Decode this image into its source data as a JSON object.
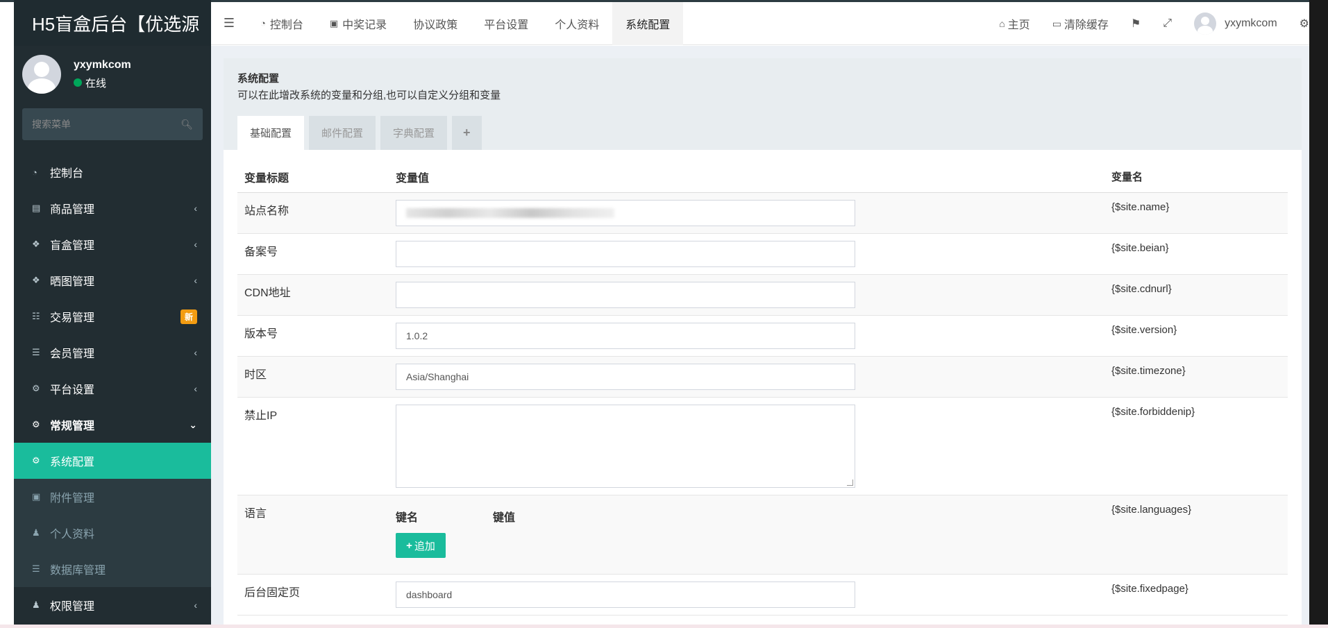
{
  "brand": {
    "title": "H5盲盒后台【优选源"
  },
  "user": {
    "name": "yxymkcom",
    "status": "在线"
  },
  "sidebar": {
    "search_placeholder": "搜索菜单",
    "items": [
      {
        "label": "控制台",
        "icon": "dashboard-icon"
      },
      {
        "label": "商品管理",
        "icon": "shopping-bag-icon"
      },
      {
        "label": "盲盒管理",
        "icon": "dropbox-icon"
      },
      {
        "label": "晒图管理",
        "icon": "dropbox-icon"
      },
      {
        "label": "交易管理",
        "icon": "cart-icon",
        "badge": "新"
      },
      {
        "label": "会员管理",
        "icon": "list-icon"
      },
      {
        "label": "平台设置",
        "icon": "cogs-icon"
      },
      {
        "label": "常规管理",
        "icon": "cogs-icon"
      },
      {
        "label": "系统配置",
        "icon": "gear-icon"
      },
      {
        "label": "附件管理",
        "icon": "image-icon"
      },
      {
        "label": "个人资料",
        "icon": "user-icon"
      },
      {
        "label": "数据库管理",
        "icon": "database-icon"
      },
      {
        "label": "权限管理",
        "icon": "group-icon"
      }
    ]
  },
  "topnav": {
    "tabs": [
      {
        "label": "控制台",
        "icon": "dashboard-icon"
      },
      {
        "label": "中奖记录",
        "icon": "gift-icon"
      },
      {
        "label": "协议政策"
      },
      {
        "label": "平台设置"
      },
      {
        "label": "个人资料"
      },
      {
        "label": "系统配置"
      }
    ],
    "right": {
      "home": "主页",
      "clear_cache": "清除缓存",
      "username": "yxymkcom"
    }
  },
  "panel": {
    "title": "系统配置",
    "description": "可以在此增改系统的变量和分组,也可以自定义分组和变量",
    "tabs": [
      "基础配置",
      "邮件配置",
      "字典配置"
    ],
    "plus": "+"
  },
  "table": {
    "headers": {
      "title": "变量标题",
      "value": "变量值",
      "name": "变量名"
    },
    "rows": [
      {
        "title": "站点名称",
        "value": "",
        "var": "{$site.name}"
      },
      {
        "title": "备案号",
        "value": "",
        "var": "{$site.beian}"
      },
      {
        "title": "CDN地址",
        "value": "",
        "var": "{$site.cdnurl}"
      },
      {
        "title": "版本号",
        "value": "1.0.2",
        "var": "{$site.version}"
      },
      {
        "title": "时区",
        "value": "Asia/Shanghai",
        "var": "{$site.timezone}"
      },
      {
        "title": "禁止IP",
        "value": "",
        "var": "{$site.forbiddenip}"
      },
      {
        "title": "语言",
        "var": "{$site.languages}",
        "key_header": "键名",
        "val_header": "键值",
        "add_button": "追加"
      },
      {
        "title": "后台固定页",
        "value": "dashboard",
        "var": "{$site.fixedpage}"
      }
    ]
  }
}
